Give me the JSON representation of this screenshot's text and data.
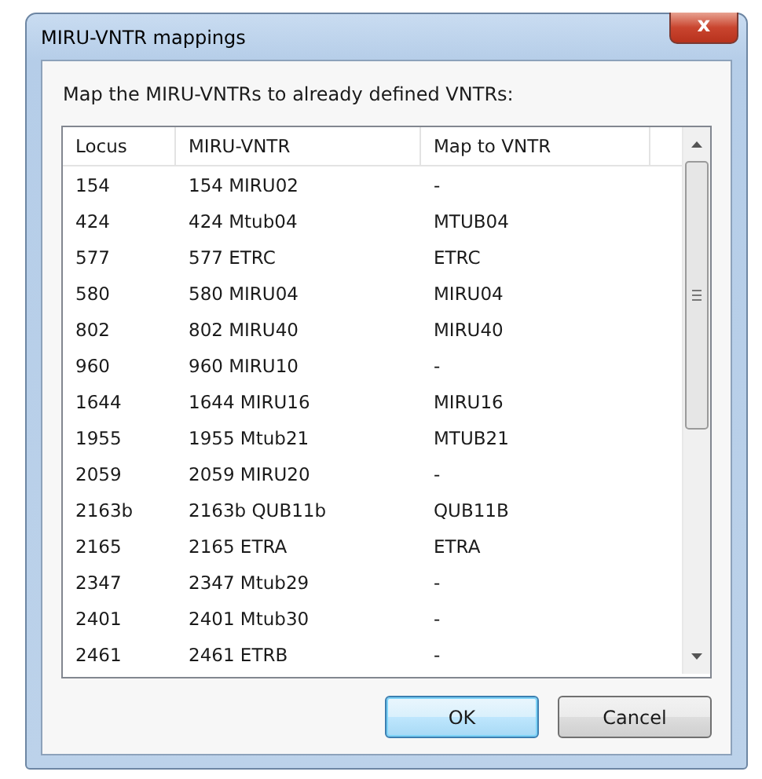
{
  "window": {
    "title": "MIRU-VNTR mappings",
    "close": "x"
  },
  "instruction": "Map the MIRU-VNTRs to already defined VNTRs:",
  "table": {
    "columns": [
      "Locus",
      "MIRU-VNTR",
      "Map to VNTR"
    ],
    "rows": [
      [
        "154",
        "154 MIRU02",
        "-"
      ],
      [
        "424",
        "424 Mtub04",
        "MTUB04"
      ],
      [
        "577",
        "577 ETRC",
        "ETRC"
      ],
      [
        "580",
        "580 MIRU04",
        "MIRU04"
      ],
      [
        "802",
        "802 MIRU40",
        "MIRU40"
      ],
      [
        "960",
        "960 MIRU10",
        "-"
      ],
      [
        "1644",
        "1644 MIRU16",
        "MIRU16"
      ],
      [
        "1955",
        "1955 Mtub21",
        "MTUB21"
      ],
      [
        "2059",
        "2059 MIRU20",
        "-"
      ],
      [
        "2163b",
        "2163b QUB11b",
        "QUB11B"
      ],
      [
        "2165",
        "2165 ETRA",
        "ETRA"
      ],
      [
        "2347",
        "2347 Mtub29",
        "-"
      ],
      [
        "2401",
        "2401 Mtub30",
        "-"
      ],
      [
        "2461",
        "2461 ETRB",
        "-"
      ]
    ]
  },
  "buttons": [
    {
      "label": "OK",
      "default": true
    },
    {
      "label": "Cancel",
      "default": false
    }
  ]
}
